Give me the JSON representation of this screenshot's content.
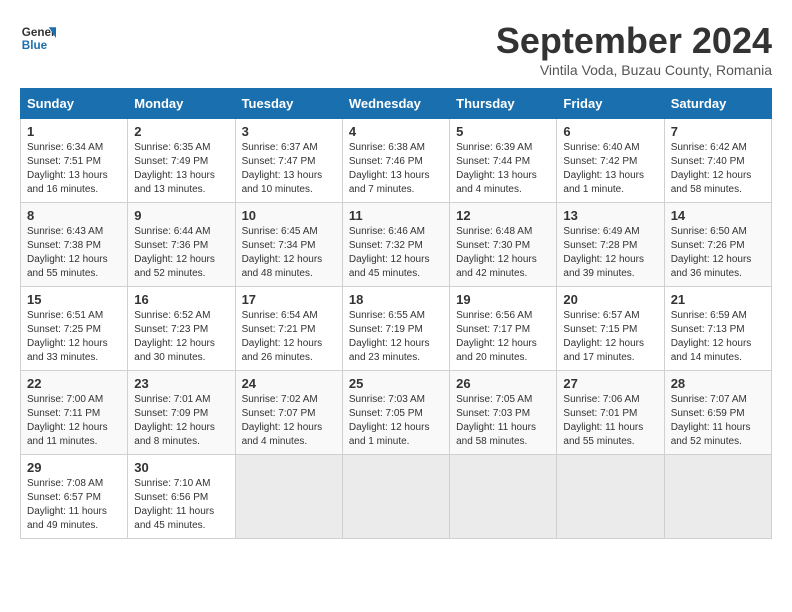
{
  "header": {
    "logo_line1": "General",
    "logo_line2": "Blue",
    "month": "September 2024",
    "location": "Vintila Voda, Buzau County, Romania"
  },
  "weekdays": [
    "Sunday",
    "Monday",
    "Tuesday",
    "Wednesday",
    "Thursday",
    "Friday",
    "Saturday"
  ],
  "weeks": [
    [
      {
        "day": "1",
        "info": "Sunrise: 6:34 AM\nSunset: 7:51 PM\nDaylight: 13 hours\nand 16 minutes."
      },
      {
        "day": "2",
        "info": "Sunrise: 6:35 AM\nSunset: 7:49 PM\nDaylight: 13 hours\nand 13 minutes."
      },
      {
        "day": "3",
        "info": "Sunrise: 6:37 AM\nSunset: 7:47 PM\nDaylight: 13 hours\nand 10 minutes."
      },
      {
        "day": "4",
        "info": "Sunrise: 6:38 AM\nSunset: 7:46 PM\nDaylight: 13 hours\nand 7 minutes."
      },
      {
        "day": "5",
        "info": "Sunrise: 6:39 AM\nSunset: 7:44 PM\nDaylight: 13 hours\nand 4 minutes."
      },
      {
        "day": "6",
        "info": "Sunrise: 6:40 AM\nSunset: 7:42 PM\nDaylight: 13 hours\nand 1 minute."
      },
      {
        "day": "7",
        "info": "Sunrise: 6:42 AM\nSunset: 7:40 PM\nDaylight: 12 hours\nand 58 minutes."
      }
    ],
    [
      {
        "day": "8",
        "info": "Sunrise: 6:43 AM\nSunset: 7:38 PM\nDaylight: 12 hours\nand 55 minutes."
      },
      {
        "day": "9",
        "info": "Sunrise: 6:44 AM\nSunset: 7:36 PM\nDaylight: 12 hours\nand 52 minutes."
      },
      {
        "day": "10",
        "info": "Sunrise: 6:45 AM\nSunset: 7:34 PM\nDaylight: 12 hours\nand 48 minutes."
      },
      {
        "day": "11",
        "info": "Sunrise: 6:46 AM\nSunset: 7:32 PM\nDaylight: 12 hours\nand 45 minutes."
      },
      {
        "day": "12",
        "info": "Sunrise: 6:48 AM\nSunset: 7:30 PM\nDaylight: 12 hours\nand 42 minutes."
      },
      {
        "day": "13",
        "info": "Sunrise: 6:49 AM\nSunset: 7:28 PM\nDaylight: 12 hours\nand 39 minutes."
      },
      {
        "day": "14",
        "info": "Sunrise: 6:50 AM\nSunset: 7:26 PM\nDaylight: 12 hours\nand 36 minutes."
      }
    ],
    [
      {
        "day": "15",
        "info": "Sunrise: 6:51 AM\nSunset: 7:25 PM\nDaylight: 12 hours\nand 33 minutes."
      },
      {
        "day": "16",
        "info": "Sunrise: 6:52 AM\nSunset: 7:23 PM\nDaylight: 12 hours\nand 30 minutes."
      },
      {
        "day": "17",
        "info": "Sunrise: 6:54 AM\nSunset: 7:21 PM\nDaylight: 12 hours\nand 26 minutes."
      },
      {
        "day": "18",
        "info": "Sunrise: 6:55 AM\nSunset: 7:19 PM\nDaylight: 12 hours\nand 23 minutes."
      },
      {
        "day": "19",
        "info": "Sunrise: 6:56 AM\nSunset: 7:17 PM\nDaylight: 12 hours\nand 20 minutes."
      },
      {
        "day": "20",
        "info": "Sunrise: 6:57 AM\nSunset: 7:15 PM\nDaylight: 12 hours\nand 17 minutes."
      },
      {
        "day": "21",
        "info": "Sunrise: 6:59 AM\nSunset: 7:13 PM\nDaylight: 12 hours\nand 14 minutes."
      }
    ],
    [
      {
        "day": "22",
        "info": "Sunrise: 7:00 AM\nSunset: 7:11 PM\nDaylight: 12 hours\nand 11 minutes."
      },
      {
        "day": "23",
        "info": "Sunrise: 7:01 AM\nSunset: 7:09 PM\nDaylight: 12 hours\nand 8 minutes."
      },
      {
        "day": "24",
        "info": "Sunrise: 7:02 AM\nSunset: 7:07 PM\nDaylight: 12 hours\nand 4 minutes."
      },
      {
        "day": "25",
        "info": "Sunrise: 7:03 AM\nSunset: 7:05 PM\nDaylight: 12 hours\nand 1 minute."
      },
      {
        "day": "26",
        "info": "Sunrise: 7:05 AM\nSunset: 7:03 PM\nDaylight: 11 hours\nand 58 minutes."
      },
      {
        "day": "27",
        "info": "Sunrise: 7:06 AM\nSunset: 7:01 PM\nDaylight: 11 hours\nand 55 minutes."
      },
      {
        "day": "28",
        "info": "Sunrise: 7:07 AM\nSunset: 6:59 PM\nDaylight: 11 hours\nand 52 minutes."
      }
    ],
    [
      {
        "day": "29",
        "info": "Sunrise: 7:08 AM\nSunset: 6:57 PM\nDaylight: 11 hours\nand 49 minutes."
      },
      {
        "day": "30",
        "info": "Sunrise: 7:10 AM\nSunset: 6:56 PM\nDaylight: 11 hours\nand 45 minutes."
      },
      {
        "day": "",
        "info": ""
      },
      {
        "day": "",
        "info": ""
      },
      {
        "day": "",
        "info": ""
      },
      {
        "day": "",
        "info": ""
      },
      {
        "day": "",
        "info": ""
      }
    ]
  ]
}
